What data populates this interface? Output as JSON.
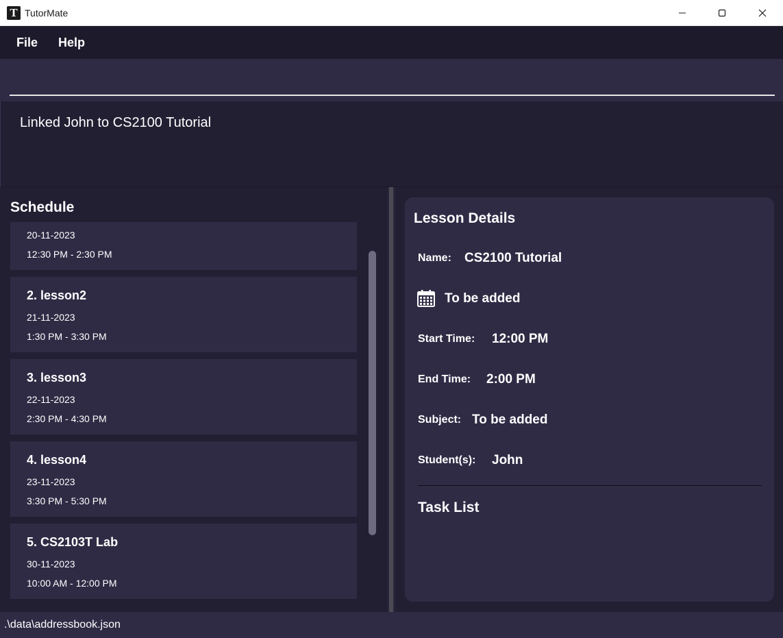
{
  "window": {
    "title": "TutorMate",
    "app_icon_letter": "T",
    "minimize_icon": "minimize-icon",
    "maximize_icon": "maximize-icon",
    "close_icon": "close-icon"
  },
  "menu": {
    "items": [
      {
        "label": "File"
      },
      {
        "label": "Help"
      }
    ]
  },
  "command": {
    "value": "",
    "placeholder": ""
  },
  "result": {
    "text": "Linked John to CS2100 Tutorial"
  },
  "schedule": {
    "title": "Schedule",
    "lessons": [
      {
        "name": "",
        "date": "20-11-2023",
        "time": "12:30 PM - 2:30 PM"
      },
      {
        "name": "2.  lesson2",
        "date": "21-11-2023",
        "time": "1:30 PM - 3:30 PM"
      },
      {
        "name": "3.  lesson3",
        "date": "22-11-2023",
        "time": "2:30 PM - 4:30 PM"
      },
      {
        "name": "4.  lesson4",
        "date": "23-11-2023",
        "time": "3:30 PM - 5:30 PM"
      },
      {
        "name": "5.  CS2103T Lab",
        "date": "30-11-2023",
        "time": "10:00 AM - 12:00 PM"
      }
    ]
  },
  "details": {
    "title": "Lesson Details",
    "name_label": "Name:",
    "name_value": "CS2100 Tutorial",
    "date_icon": "calendar-icon",
    "date_value": "To be added",
    "start_label": "Start Time:",
    "start_value": "12:00 PM",
    "end_label": "End Time:",
    "end_value": "2:00 PM",
    "subject_label": "Subject:",
    "subject_value": "To be added",
    "students_label": "Student(s):",
    "students_value": "John",
    "tasklist_title": "Task List"
  },
  "status": {
    "path": ".\\data\\addressbook.json"
  },
  "colors": {
    "background": "#231f33",
    "panel": "#302b45",
    "menubar": "#1d1a2b"
  }
}
